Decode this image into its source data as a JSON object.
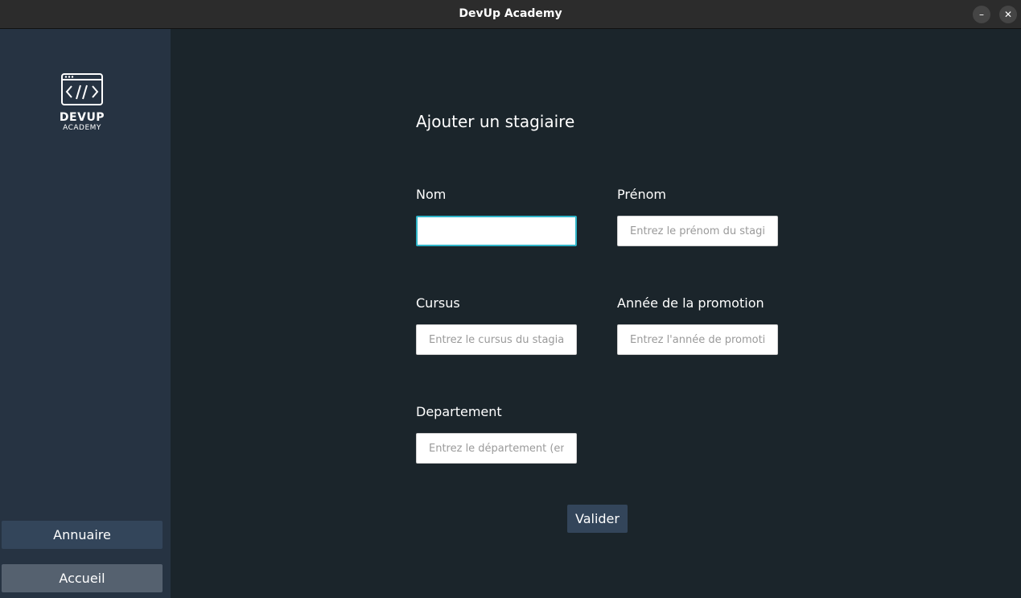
{
  "window": {
    "title": "DevUp Academy",
    "minimize_glyph": "–",
    "close_glyph": "✕"
  },
  "sidebar": {
    "logo_title": "DEVUP",
    "logo_subtitle": "ACADEMY",
    "logo_icon": "code-window-icon",
    "nav": [
      {
        "label": "Annuaire"
      },
      {
        "label": "Accueil"
      }
    ]
  },
  "form": {
    "title": "Ajouter un stagiaire",
    "fields": {
      "nom": {
        "label": "Nom",
        "value": "",
        "placeholder": ""
      },
      "prenom": {
        "label": "Prénom",
        "value": "",
        "placeholder": "Entrez le prénom du stagiai"
      },
      "cursus": {
        "label": "Cursus",
        "value": "",
        "placeholder": "Entrez le cursus du stagiaire"
      },
      "annee": {
        "label": "Année de la promotion",
        "value": "",
        "placeholder": "Entrez l'année de promotior"
      },
      "departement": {
        "label": "Departement",
        "value": "",
        "placeholder": "Entrez le département (en c"
      }
    },
    "submit_label": "Valider"
  },
  "colors": {
    "background": "#1b252b",
    "sidebar": "#263342",
    "button": "#33455a",
    "focus": "#2fb4c8"
  }
}
